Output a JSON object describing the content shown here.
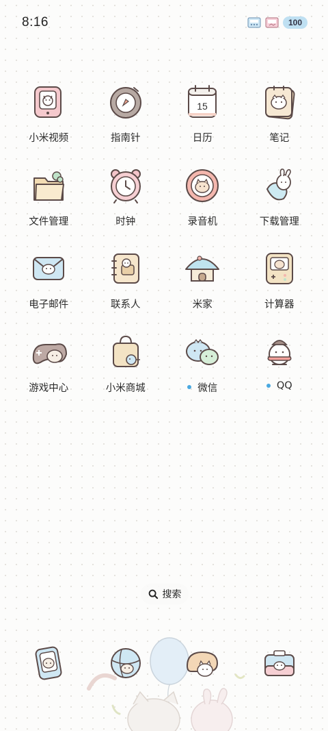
{
  "status_bar": {
    "time": "8:16",
    "battery": "100"
  },
  "apps": [
    {
      "label": "小米视频",
      "icon": "video-icon"
    },
    {
      "label": "指南针",
      "icon": "compass-icon"
    },
    {
      "label": "日历",
      "icon": "calendar-icon",
      "calendar_day": "15"
    },
    {
      "label": "笔记",
      "icon": "notes-icon"
    },
    {
      "label": "文件管理",
      "icon": "folder-icon"
    },
    {
      "label": "时钟",
      "icon": "clock-icon"
    },
    {
      "label": "录音机",
      "icon": "recorder-icon"
    },
    {
      "label": "下载管理",
      "icon": "download-icon"
    },
    {
      "label": "电子邮件",
      "icon": "mail-icon"
    },
    {
      "label": "联系人",
      "icon": "contacts-icon"
    },
    {
      "label": "米家",
      "icon": "home-icon"
    },
    {
      "label": "计算器",
      "icon": "calculator-icon"
    },
    {
      "label": "游戏中心",
      "icon": "game-icon"
    },
    {
      "label": "小米商城",
      "icon": "shop-icon"
    },
    {
      "label": "微信",
      "icon": "wechat-icon",
      "new_dot": true
    },
    {
      "label": "QQ",
      "icon": "qq-icon",
      "new_dot": true
    }
  ],
  "search": {
    "label": "搜索"
  },
  "dock": [
    {
      "icon": "phone-icon"
    },
    {
      "icon": "browser-globe-icon"
    },
    {
      "icon": "messages-icon"
    },
    {
      "icon": "camera-icon"
    }
  ],
  "colors": {
    "new_dot": "#4aa8e0",
    "background": "#fcfcfb"
  }
}
